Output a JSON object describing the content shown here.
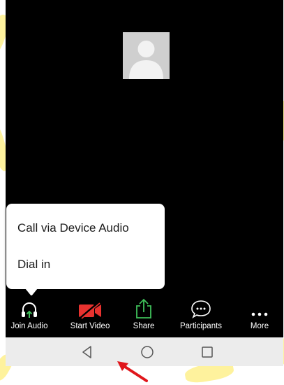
{
  "meeting": {
    "avatar_icon": "user-avatar-icon"
  },
  "audio_popup": {
    "options": [
      {
        "label": "Call via Device Audio"
      },
      {
        "label": "Dial in"
      }
    ]
  },
  "toolbar": {
    "items": [
      {
        "label": "Join Audio",
        "icon": "headphones-icon",
        "color": "#ffffff",
        "accent": "#3fbf5a"
      },
      {
        "label": "Start Video",
        "icon": "video-off-icon",
        "color": "#e8322f"
      },
      {
        "label": "Share",
        "icon": "share-icon",
        "color": "#3fbf5a"
      },
      {
        "label": "Participants",
        "icon": "chat-bubble-icon",
        "color": "#ffffff"
      },
      {
        "label": "More",
        "icon": "more-dots-icon",
        "color": "#ffffff"
      }
    ]
  },
  "navbar": {
    "buttons": [
      "back-icon",
      "home-icon",
      "recent-apps-icon"
    ]
  },
  "annotation": {
    "arrow_color": "#e0161b"
  },
  "colors": {
    "video_background": "#000000",
    "highlight": "#fde74c"
  }
}
